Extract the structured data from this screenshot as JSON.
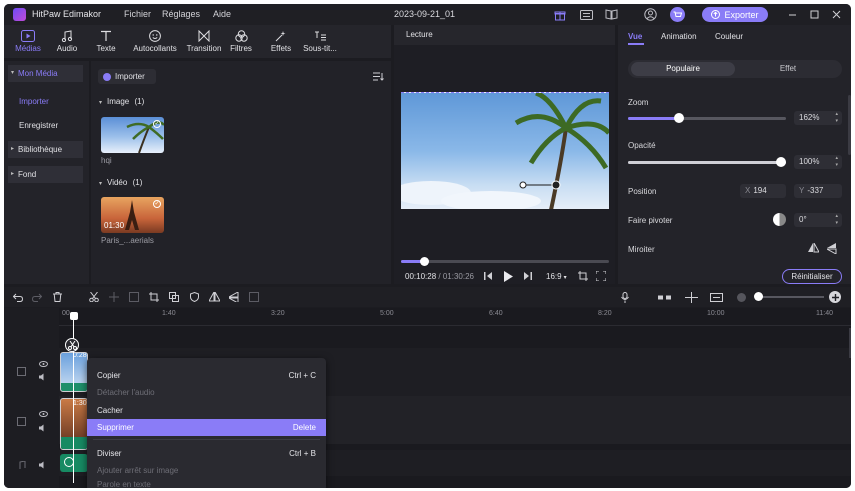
{
  "app": {
    "title": "HitPaw Edimakor",
    "project_name": "2023-09-21_01",
    "export_label": "Exporter"
  },
  "menu": [
    "Fichier",
    "Réglages",
    "Aide"
  ],
  "toolbar": {
    "tools": [
      {
        "label": "Médias",
        "icon": "media-icon",
        "active": true
      },
      {
        "label": "Audio",
        "icon": "music-note-icon"
      },
      {
        "label": "Texte",
        "icon": "text-icon"
      },
      {
        "label": "Autocollants",
        "icon": "sticker-icon"
      },
      {
        "label": "Transition",
        "icon": "transition-icon"
      },
      {
        "label": "Filtres",
        "icon": "filter-icon"
      },
      {
        "label": "Effets",
        "icon": "effects-icon"
      },
      {
        "label": "Sous-tit...",
        "icon": "subtitle-icon"
      }
    ]
  },
  "media_nav": {
    "items": [
      "Mon Média",
      "Importer",
      "Enregistrer",
      "Bibliothèque",
      "Fond"
    ]
  },
  "media_library": {
    "import_label": "Importer",
    "image_group": "Image",
    "image_count": "(1)",
    "image_name": "hqi",
    "video_group": "Vidéo",
    "video_count": "(1)",
    "video_name": "Paris_...aerials",
    "video_duration": "01:30"
  },
  "preview": {
    "title": "Lecture",
    "current_time": "00:10:28",
    "total_time": "/ 01:30:26",
    "aspect": "16:9",
    "progress": 0.11
  },
  "inspector": {
    "tabs": [
      "Vue",
      "Animation",
      "Couleur"
    ],
    "subtabs": [
      "Populaire",
      "Effet"
    ],
    "zoom_label": "Zoom",
    "zoom_value": "162%",
    "zoom_level": 0.32,
    "opacity_label": "Opacité",
    "opacity_value": "100%",
    "opacity_level": 1.0,
    "position_label": "Position",
    "pos_x": "194",
    "pos_y": "-337",
    "rotate_label": "Faire pivoter",
    "rotate_value": "0°",
    "mirror_label": "Miroiter",
    "reset_label": "Réinitialiser",
    "accent": "#8a7cf7"
  },
  "timeline": {
    "ruler": [
      "00",
      "1:40",
      "3:20",
      "5:00",
      "6:40",
      "8:20",
      "10:00",
      "11:40"
    ],
    "playhead_label": "0:28",
    "clip_label_2": "1:30"
  },
  "context_menu": {
    "items": [
      {
        "label": "Copier",
        "shortcut": "Ctrl + C"
      },
      {
        "label": "Détacher l'audio",
        "disabled": true
      },
      {
        "label": "Cacher"
      },
      {
        "label": "Supprimer",
        "shortcut": "Delete",
        "highlighted": true
      },
      {
        "label": "Diviser",
        "shortcut": "Ctrl + B"
      },
      {
        "label": "Ajouter arrêt sur image",
        "disabled": true
      },
      {
        "label": "Parole en texte",
        "disabled": true
      }
    ]
  }
}
